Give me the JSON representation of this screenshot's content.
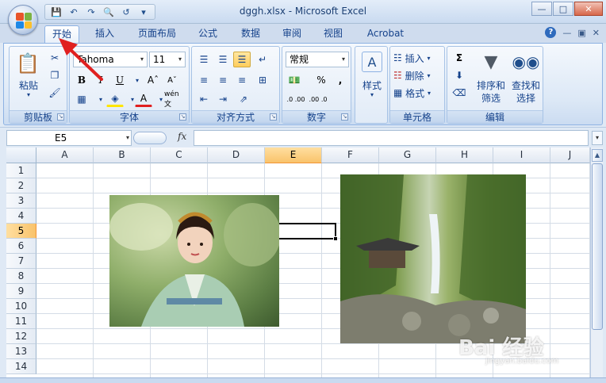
{
  "window": {
    "title": "dggh.xlsx - Microsoft Excel"
  },
  "tabs": [
    {
      "label": "开始"
    },
    {
      "label": "插入"
    },
    {
      "label": "页面布局"
    },
    {
      "label": "公式"
    },
    {
      "label": "数据"
    },
    {
      "label": "审阅"
    },
    {
      "label": "视图"
    },
    {
      "label": "Acrobat"
    }
  ],
  "ribbon": {
    "clipboard": {
      "paste_label": "粘贴",
      "group_label": "剪贴板"
    },
    "font": {
      "font_name": "Tahoma",
      "font_size": "11",
      "group_label": "字体",
      "phonetic_label": "wén 文"
    },
    "alignment": {
      "group_label": "对齐方式"
    },
    "number": {
      "format": "常规",
      "group_label": "数字",
      "percent": "%",
      "comma": ",",
      "dec_inc": ".0 .00",
      "dec_dec": ".00 .0"
    },
    "styles": {
      "label": "样式"
    },
    "cells": {
      "insert": "插入",
      "delete": "删除",
      "format": "格式",
      "group_label": "单元格"
    },
    "editing": {
      "sort_filter_1": "排序和",
      "sort_filter_2": "筛选",
      "find_select_1": "查找和",
      "find_select_2": "选择",
      "group_label": "编辑"
    }
  },
  "formula_bar": {
    "name_box": "E5",
    "fx": "fx"
  },
  "grid": {
    "columns": [
      "A",
      "B",
      "C",
      "D",
      "E",
      "F",
      "G",
      "H",
      "I",
      "J"
    ],
    "rows": [
      "1",
      "2",
      "3",
      "4",
      "5",
      "6",
      "7",
      "8",
      "9",
      "10",
      "11",
      "12",
      "13",
      "14"
    ],
    "selected_column": "E",
    "selected_row": "5"
  },
  "watermark": {
    "main": "Bai 经验",
    "sub": "jingyan.baidu.com"
  },
  "colors": {
    "accent": "#15428b",
    "selection": "#f9c36b",
    "arrow": "#e02020"
  }
}
